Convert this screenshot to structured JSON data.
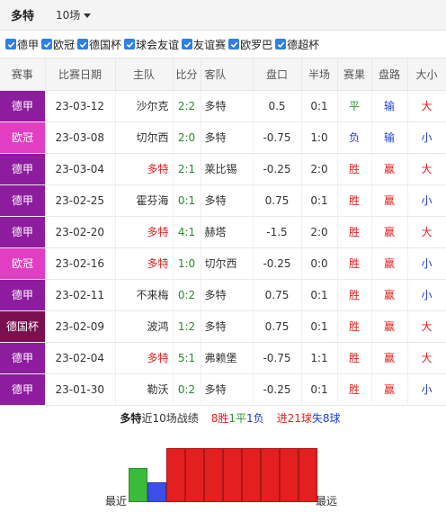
{
  "header": {
    "team": "多特",
    "count": "10场"
  },
  "filters": [
    "德甲",
    "欧冠",
    "德国杯",
    "球会友谊",
    "友谊赛",
    "欧罗巴",
    "德超杯"
  ],
  "columns": [
    "赛事",
    "比赛日期",
    "主队",
    "比分",
    "客队",
    "盘口",
    "半场",
    "赛果",
    "盘路",
    "大小"
  ],
  "colors": {
    "bundesliga": "#8d1c9e",
    "ucl": "#e23ec3",
    "dfbpokal": "#7a1050",
    "checkbox": "#2f7fe6"
  },
  "rows": [
    {
      "league": "德甲",
      "league_color": "#8d1c9e",
      "date": "23-03-12",
      "home": "沙尔克",
      "home_red": false,
      "score": "2:2",
      "away": "多特",
      "away_red": false,
      "handicap": "0.5",
      "half": "0:1",
      "half_class": "half-win",
      "result": "平",
      "result_class": "draw",
      "pan": "输",
      "pan_class": "lose",
      "ou": "大",
      "ou_class": "win"
    },
    {
      "league": "欧冠",
      "league_color": "#e23ec3",
      "date": "23-03-08",
      "home": "切尔西",
      "home_red": false,
      "score": "2:0",
      "away": "多特",
      "away_red": false,
      "handicap": "-0.75",
      "half": "1:0",
      "half_class": "",
      "result": "负",
      "result_class": "lose",
      "pan": "输",
      "pan_class": "lose",
      "ou": "小",
      "ou_class": "lose"
    },
    {
      "league": "德甲",
      "league_color": "#8d1c9e",
      "date": "23-03-04",
      "home": "多特",
      "home_red": true,
      "score": "2:1",
      "away": "莱比锡",
      "away_red": false,
      "handicap": "-0.25",
      "half": "2:0",
      "half_class": "half-win",
      "result": "胜",
      "result_class": "win",
      "pan": "赢",
      "pan_class": "win",
      "ou": "大",
      "ou_class": "win"
    },
    {
      "league": "德甲",
      "league_color": "#8d1c9e",
      "date": "23-02-25",
      "home": "霍芬海",
      "home_red": false,
      "score": "0:1",
      "away": "多特",
      "away_red": false,
      "handicap": "0.75",
      "half": "0:1",
      "half_class": "half-win",
      "result": "胜",
      "result_class": "win",
      "pan": "赢",
      "pan_class": "win",
      "ou": "小",
      "ou_class": "lose"
    },
    {
      "league": "德甲",
      "league_color": "#8d1c9e",
      "date": "23-02-20",
      "home": "多特",
      "home_red": true,
      "score": "4:1",
      "away": "赫塔",
      "away_red": false,
      "handicap": "-1.5",
      "half": "2:0",
      "half_class": "half-win",
      "result": "胜",
      "result_class": "win",
      "pan": "赢",
      "pan_class": "win",
      "ou": "大",
      "ou_class": "win"
    },
    {
      "league": "欧冠",
      "league_color": "#e23ec3",
      "date": "23-02-16",
      "home": "多特",
      "home_red": true,
      "score": "1:0",
      "away": "切尔西",
      "away_red": false,
      "handicap": "-0.25",
      "half": "0:0",
      "half_class": "half-draw",
      "result": "胜",
      "result_class": "win",
      "pan": "赢",
      "pan_class": "win",
      "ou": "小",
      "ou_class": "lose"
    },
    {
      "league": "德甲",
      "league_color": "#8d1c9e",
      "date": "23-02-11",
      "home": "不来梅",
      "home_red": false,
      "score": "0:2",
      "away": "多特",
      "away_red": false,
      "handicap": "0.75",
      "half": "0:1",
      "half_class": "half-win",
      "result": "胜",
      "result_class": "win",
      "pan": "赢",
      "pan_class": "win",
      "ou": "小",
      "ou_class": "lose"
    },
    {
      "league": "德国杯",
      "league_color": "#7a1050",
      "date": "23-02-09",
      "home": "波鸿",
      "home_red": false,
      "score": "1:2",
      "away": "多特",
      "away_red": false,
      "handicap": "0.75",
      "half": "0:1",
      "half_class": "half-win",
      "result": "胜",
      "result_class": "win",
      "pan": "赢",
      "pan_class": "win",
      "ou": "大",
      "ou_class": "win"
    },
    {
      "league": "德甲",
      "league_color": "#8d1c9e",
      "date": "23-02-04",
      "home": "多特",
      "home_red": true,
      "score": "5:1",
      "away": "弗赖堡",
      "away_red": false,
      "handicap": "-0.75",
      "half": "1:1",
      "half_class": "half-draw",
      "result": "胜",
      "result_class": "win",
      "pan": "赢",
      "pan_class": "win",
      "ou": "大",
      "ou_class": "win"
    },
    {
      "league": "德甲",
      "league_color": "#8d1c9e",
      "date": "23-01-30",
      "home": "勒沃",
      "home_red": false,
      "score": "0:2",
      "away": "多特",
      "away_red": false,
      "handicap": "-0.25",
      "half": "0:1",
      "half_class": "half-win",
      "result": "胜",
      "result_class": "win",
      "pan": "赢",
      "pan_class": "win",
      "ou": "小",
      "ou_class": "lose"
    }
  ],
  "summary": {
    "team": "多特",
    "label": "近10场战绩",
    "wins": "8胜",
    "draws": "1平",
    "losses": "1负",
    "goals_for": "进21球",
    "goals_against": "失8球"
  },
  "trend": {
    "oldest_label": "最近",
    "newest_label": "最远",
    "results": [
      "draw",
      "lose",
      "win",
      "win",
      "win",
      "win",
      "win",
      "win",
      "win",
      "win"
    ],
    "colors": {
      "win": "#e31f1f",
      "draw": "#3bbb3b",
      "lose": "#3b4fe6"
    }
  }
}
